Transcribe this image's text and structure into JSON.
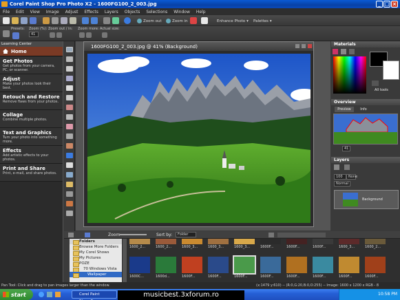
{
  "window": {
    "title": "Corel Paint Shop Pro Photo X2 - 1600FG100_2_003.jpg"
  },
  "menu": [
    "File",
    "Edit",
    "View",
    "Image",
    "Adjust",
    "Effects",
    "Layers",
    "Objects",
    "Selections",
    "Window",
    "Help"
  ],
  "toolbar": {
    "zoom_out": "Zoom out",
    "zoom_in": "Zoom in",
    "enhance_photo": "Enhance Photo",
    "palettes": "Palettes",
    "presets": "Presets:",
    "zoom_pct": "Zoom (%):",
    "zoom_out_in": "Zoom out / in:",
    "zoom_more": "Zoom more:",
    "actual_size": "Actual size:",
    "zoom_value": "41"
  },
  "learning_center": {
    "header": "Learning Center",
    "home": "Home",
    "items": [
      {
        "title": "Get Photos",
        "desc": "Get photos from your camera, PC, or scanner."
      },
      {
        "title": "Adjust",
        "desc": "Make your photos look their best."
      },
      {
        "title": "Retouch and Restore",
        "desc": "Remove flaws from your photos."
      },
      {
        "title": "Collage",
        "desc": "Combine multiple photos."
      },
      {
        "title": "Text and Graphics",
        "desc": "Turn your photo into something more."
      },
      {
        "title": "Effects",
        "desc": "Add artistic effects to your photos."
      },
      {
        "title": "Print and Share",
        "desc": "Print, e-mail, and share photos."
      }
    ]
  },
  "document": {
    "title": "1600FG100_2_003.jpg @  41% (Background)"
  },
  "materials": {
    "title": "Materials",
    "all_tools": "All tools"
  },
  "overview": {
    "title": "Overview",
    "tab_preview": "Preview",
    "tab_info": "Info",
    "zoom": "41"
  },
  "layers": {
    "title": "Layers",
    "opacity": "100",
    "blend": "Normal",
    "mode": "None",
    "layer_name": "Background"
  },
  "organizer": {
    "zoom_label": "Zoom",
    "sort_label": "Sort by:",
    "sort_value": "Folder",
    "folders_title": "Folders",
    "folders": [
      "Browse More Folders",
      "My Corel Shows",
      "My Pictures",
      "POZE",
      "70 Windows Vista",
      "Wallpaper"
    ],
    "thumbs_row1": [
      "1600_2...",
      "1600_2...",
      "1600_3...",
      "1600_3...",
      "1600_3...",
      "1600F...",
      "1600F...",
      "1600F...",
      "1600_3...",
      "1600_2..."
    ],
    "thumbs_row2": [
      "1600C...",
      "1600d...",
      "1600F...",
      "1600F...",
      "1600F...",
      "1600F...",
      "1600F...",
      "1600F...",
      "1600F...",
      "1600F..."
    ]
  },
  "statusbar": {
    "left": "Pan Tool: Click and drag to pan images larger than the window.",
    "coords": "(x:1479 y:610) -- (R:0,G:20,B:0,O:255) -- Image: 1600 x 1200 x RGB - 8 bits/channel"
  },
  "taskbar": {
    "start": "start",
    "item": "Corel Paint Shop_Pr...",
    "watermark": "musicbest.3xforum.ro",
    "clock": "10:58 PM"
  }
}
